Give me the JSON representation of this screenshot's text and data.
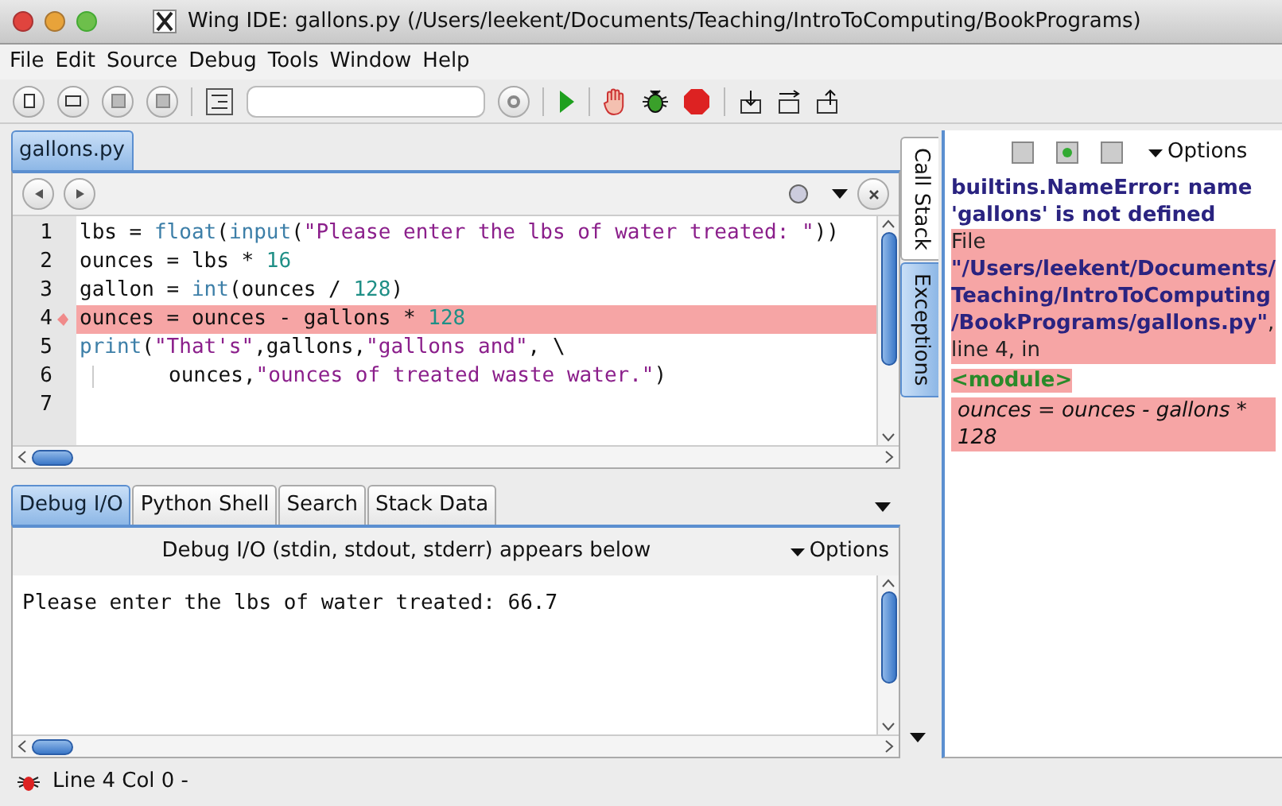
{
  "window": {
    "title": "Wing IDE: gallons.py (/Users/leekent/Documents/Teaching/IntroToComputing/BookPrograms)"
  },
  "menu": [
    "File",
    "Edit",
    "Source",
    "Debug",
    "Tools",
    "Window",
    "Help"
  ],
  "editor_tabs": [
    {
      "label": "gallons.py",
      "selected": true
    }
  ],
  "code": [
    {
      "number": "1",
      "current": false,
      "tokens": [
        {
          "kind": "plain",
          "text": "lbs = "
        },
        {
          "kind": "builtin",
          "text": "float"
        },
        {
          "kind": "plain",
          "text": "("
        },
        {
          "kind": "builtin",
          "text": "input"
        },
        {
          "kind": "plain",
          "text": "("
        },
        {
          "kind": "string",
          "text": "\"Please enter the lbs of water treated: \""
        },
        {
          "kind": "plain",
          "text": "))"
        }
      ]
    },
    {
      "number": "2",
      "current": false,
      "tokens": [
        {
          "kind": "plain",
          "text": "ounces = lbs * "
        },
        {
          "kind": "number",
          "text": "16"
        }
      ]
    },
    {
      "number": "3",
      "current": false,
      "tokens": [
        {
          "kind": "plain",
          "text": "gallon = "
        },
        {
          "kind": "builtin",
          "text": "int"
        },
        {
          "kind": "plain",
          "text": "(ounces / "
        },
        {
          "kind": "number",
          "text": "128"
        },
        {
          "kind": "plain",
          "text": ")"
        }
      ]
    },
    {
      "number": "4",
      "current": true,
      "tokens": [
        {
          "kind": "plain",
          "text": "ounces = ounces - gallons * "
        },
        {
          "kind": "number",
          "text": "128"
        }
      ]
    },
    {
      "number": "5",
      "current": false,
      "tokens": [
        {
          "kind": "builtin",
          "text": "print"
        },
        {
          "kind": "plain",
          "text": "("
        },
        {
          "kind": "string",
          "text": "\"That's\""
        },
        {
          "kind": "plain",
          "text": ",gallons,"
        },
        {
          "kind": "string",
          "text": "\"gallons and\""
        },
        {
          "kind": "plain",
          "text": ", \\"
        }
      ]
    },
    {
      "number": "6",
      "current": false,
      "tokens": [
        {
          "kind": "indent"
        },
        {
          "kind": "plain",
          "text": "ounces,"
        },
        {
          "kind": "string",
          "text": "\"ounces of treated waste water.\""
        },
        {
          "kind": "plain",
          "text": ")"
        }
      ]
    },
    {
      "number": "7",
      "current": false
    }
  ],
  "bottom_tabs": [
    {
      "label": "Debug I/O",
      "selected": true
    },
    {
      "label": "Python Shell",
      "selected": false
    },
    {
      "label": "Search",
      "selected": false
    },
    {
      "label": "Stack Data",
      "selected": false
    }
  ],
  "debug_io": {
    "header": "Debug I/O (stdin, stdout, stderr) appears below",
    "options": "Options",
    "output": "Please enter the lbs of water treated: 66.7"
  },
  "side_tabs": [
    {
      "label": "Call Stack",
      "selected": false
    },
    {
      "label": "Exceptions",
      "selected": true
    }
  ],
  "exceptions": {
    "options": "Options",
    "error": "builtins.NameError: name 'gallons' is not defined",
    "location": "File **\"/Users/leekent/Documents/Teaching/IntroToComputing/BookPrograms/gallons.py\"**, line 4, in",
    "module": "<module>",
    "source": "ounces = ounces - gallons * 128"
  },
  "status_bar": {
    "text": "Line 4 Col 0 -"
  }
}
